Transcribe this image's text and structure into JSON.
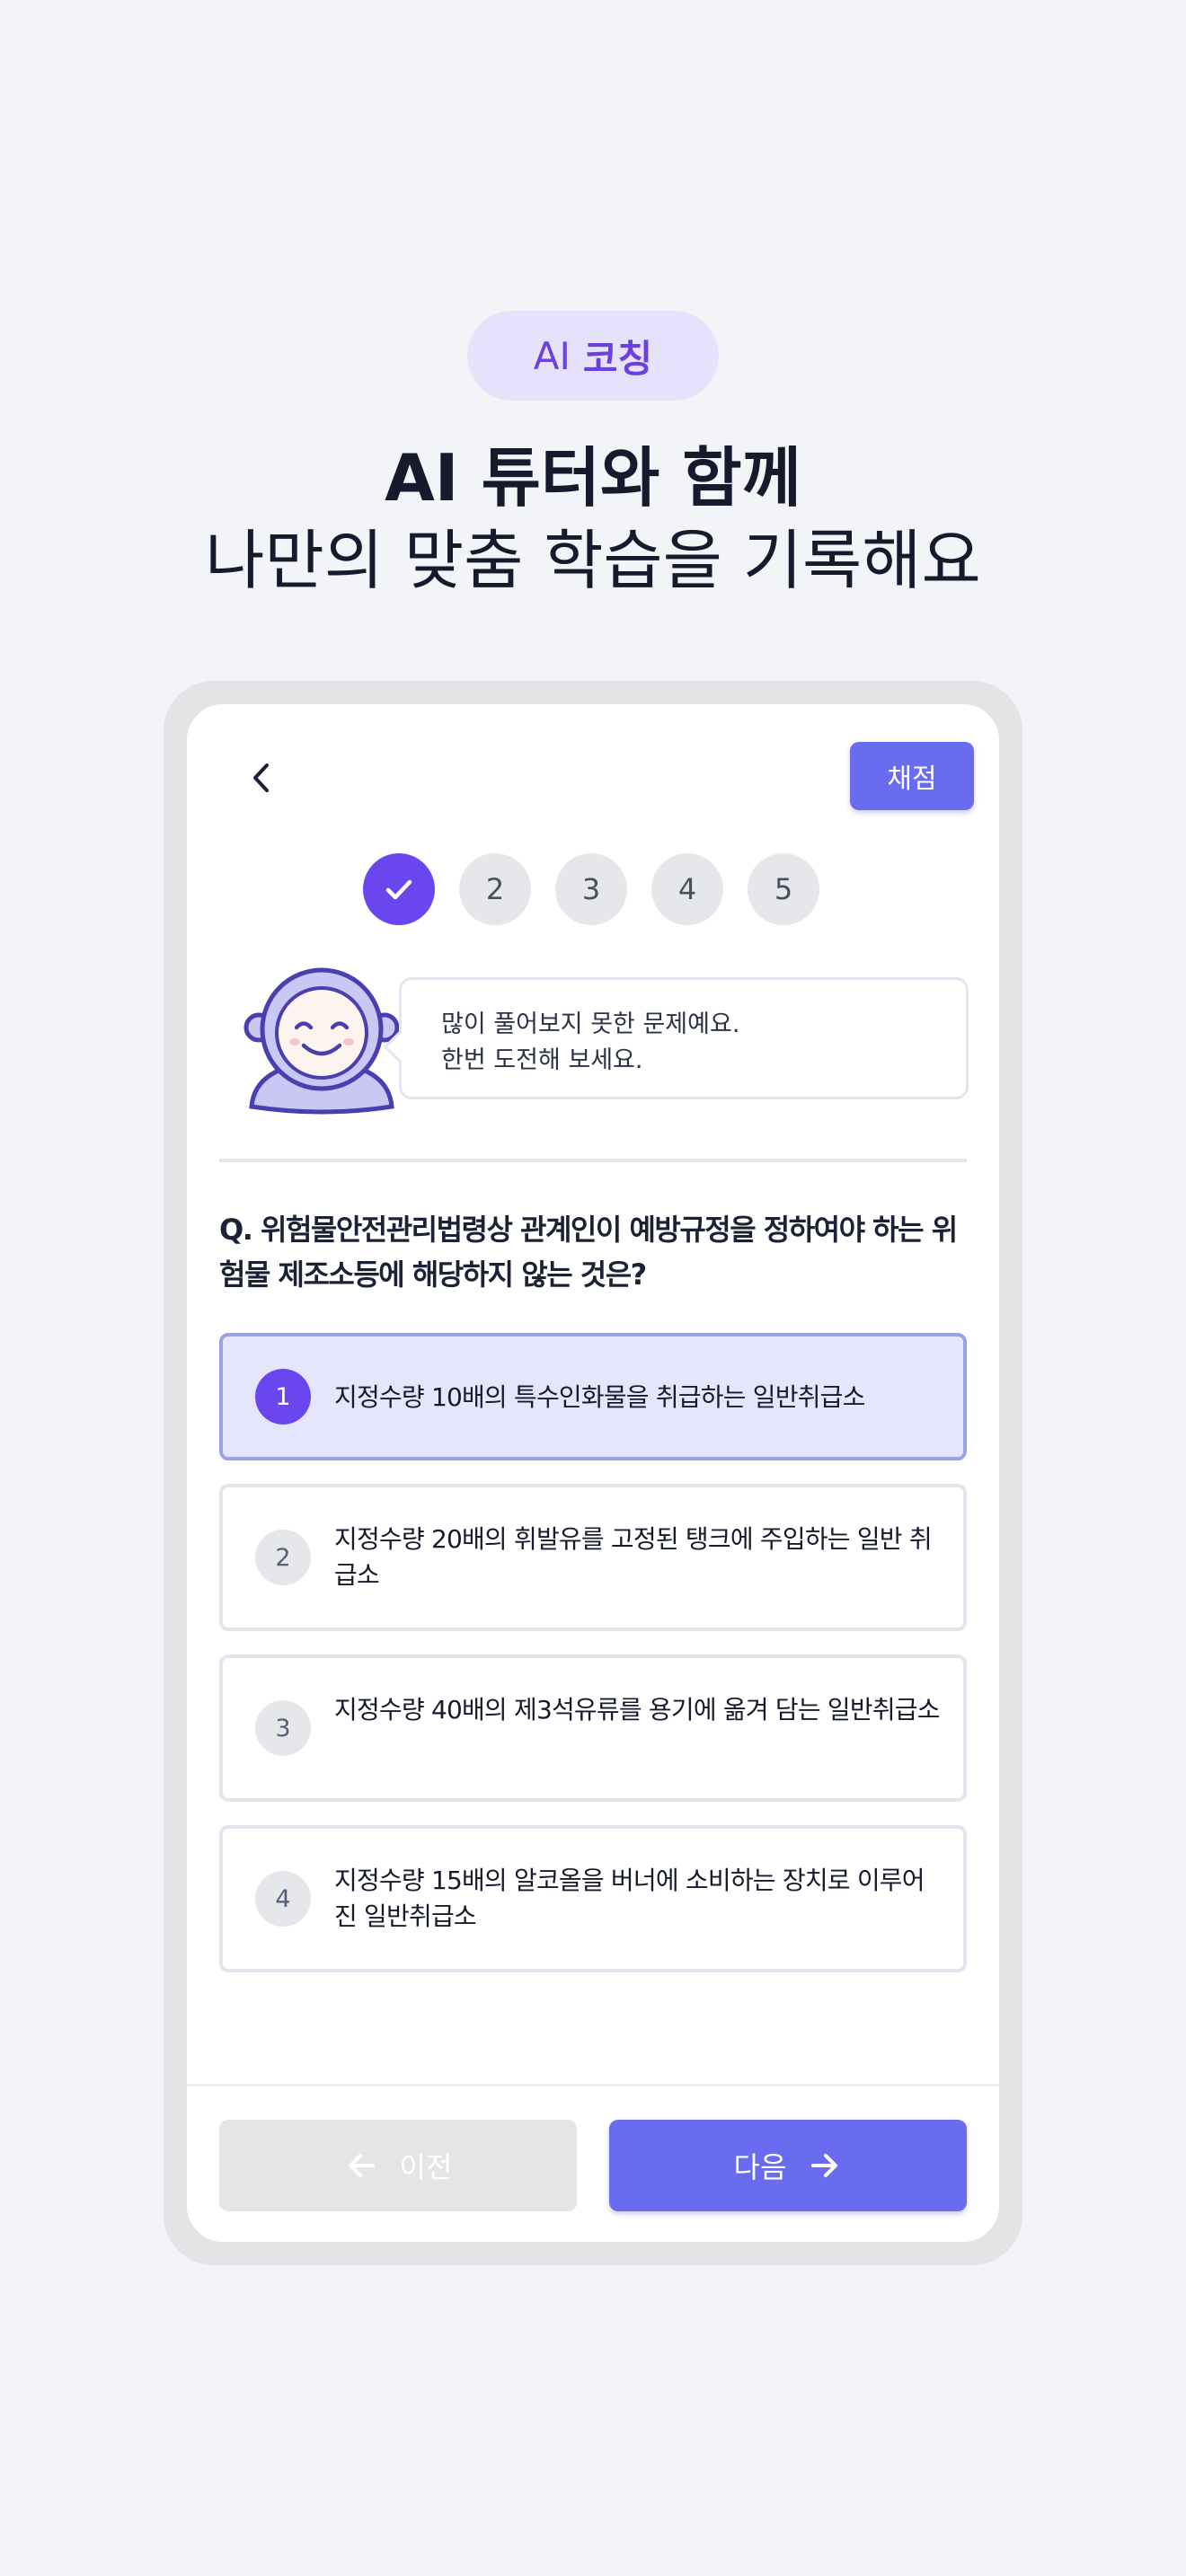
{
  "header": {
    "badge_prefix": "AI",
    "badge_label": "코칭",
    "headline": "AI 튜터와 함께",
    "subheadline": "나만의 맞춤 학습을 기록해요"
  },
  "toolbar": {
    "back_icon": "chevron-left-icon",
    "grade_label": "채점"
  },
  "steps": [
    {
      "label": "",
      "state": "done",
      "icon": "check-icon"
    },
    {
      "label": "2",
      "state": "pending"
    },
    {
      "label": "3",
      "state": "pending"
    },
    {
      "label": "4",
      "state": "pending"
    },
    {
      "label": "5",
      "state": "pending"
    }
  ],
  "tutor": {
    "avatar_icon": "smiling-tutor-avatar",
    "message": "많이 풀어보지 못한 문제예요.\n한번 도전해 보세요."
  },
  "question": {
    "text": "Q. 위험물안전관리법령상 관계인이 예방규정을 정하여야 하는 위험물 제조소등에 해당하지 않는 것은?"
  },
  "options": [
    {
      "num": "1",
      "text": "지정수량 10배의 특수인화물을 취급하는 일반취급소",
      "selected": true
    },
    {
      "num": "2",
      "text": "지정수량 20배의 휘발유를 고정된 탱크에 주입하는 일반 취급소",
      "selected": false
    },
    {
      "num": "3",
      "text": "지정수량 40배의 제3석유류를 용기에 옮겨 담는 일반취급소",
      "selected": false
    },
    {
      "num": "4",
      "text": "지정수량 15배의 알코올을 버너에 소비하는 장치로 이루어진 일반취급소",
      "selected": false
    }
  ],
  "nav": {
    "prev_label": "이전",
    "next_label": "다음",
    "prev_icon": "arrow-left-icon",
    "next_icon": "arrow-right-icon"
  },
  "colors": {
    "accent": "#6a6cf0",
    "step_done": "#6a46ef",
    "badge_bg": "#e6e2fb",
    "badge_text": "#6b3fe0",
    "selected_bg": "#e5e5fd"
  }
}
